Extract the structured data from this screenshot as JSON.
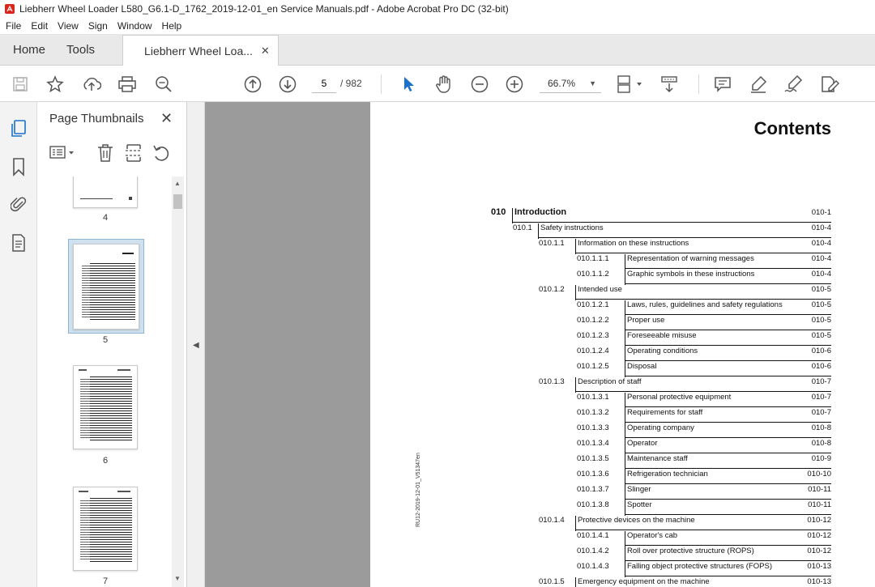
{
  "window": {
    "title": "Liebherr Wheel Loader L580_G6.1-D_1762_2019-12-01_en Service Manuals.pdf - Adobe Acrobat Pro DC (32-bit)"
  },
  "menu": [
    "File",
    "Edit",
    "View",
    "Sign",
    "Window",
    "Help"
  ],
  "tabs": {
    "home": "Home",
    "tools": "Tools",
    "document": "Liebherr Wheel Loa..."
  },
  "toolbar": {
    "current_page": "5",
    "total_pages": "/ 982",
    "zoom": "66.7%",
    "icons": [
      "save-icon",
      "bookmark-star-icon",
      "cloud-upload-icon",
      "print-icon",
      "search-zoom-icon",
      "page-up-icon",
      "page-down-icon",
      "select-cursor-icon",
      "hand-icon",
      "zoom-out-icon",
      "zoom-in-icon",
      "page-fit-icon",
      "scroll-mode-icon",
      "comment-icon",
      "highlight-icon",
      "sign-icon",
      "fill-sign-icon"
    ]
  },
  "panel": {
    "title": "Page Thumbnails",
    "thumbnails": [
      {
        "label": "4"
      },
      {
        "label": "5",
        "selected": true
      },
      {
        "label": "6"
      },
      {
        "label": "7"
      }
    ]
  },
  "document": {
    "heading": "Contents",
    "side_code": "RU12-2019-12-01_V51347en",
    "toc": [
      {
        "level": 0,
        "num": "010",
        "label": "Introduction",
        "page": "010-1"
      },
      {
        "level": 1,
        "num": "010.1",
        "label": "Safety instructions",
        "page": "010-4"
      },
      {
        "level": 2,
        "num": "010.1.1",
        "label": "Information on these instructions",
        "page": "010-4"
      },
      {
        "level": 3,
        "num": "010.1.1.1",
        "label": "Representation of warning messages",
        "page": "010-4"
      },
      {
        "level": 3,
        "num": "010.1.1.2",
        "label": "Graphic symbols in these instructions",
        "page": "010-4"
      },
      {
        "level": 2,
        "num": "010.1.2",
        "label": "Intended use",
        "page": "010-5"
      },
      {
        "level": 3,
        "num": "010.1.2.1",
        "label": "Laws, rules, guidelines and safety regulations",
        "page": "010-5"
      },
      {
        "level": 3,
        "num": "010.1.2.2",
        "label": "Proper use",
        "page": "010-5"
      },
      {
        "level": 3,
        "num": "010.1.2.3",
        "label": "Foreseeable misuse",
        "page": "010-5"
      },
      {
        "level": 3,
        "num": "010.1.2.4",
        "label": "Operating conditions",
        "page": "010-6"
      },
      {
        "level": 3,
        "num": "010.1.2.5",
        "label": "Disposal",
        "page": "010-6"
      },
      {
        "level": 2,
        "num": "010.1.3",
        "label": "Description of staff",
        "page": "010-7"
      },
      {
        "level": 3,
        "num": "010.1.3.1",
        "label": "Personal protective equipment",
        "page": "010-7"
      },
      {
        "level": 3,
        "num": "010.1.3.2",
        "label": "Requirements for staff",
        "page": "010-7"
      },
      {
        "level": 3,
        "num": "010.1.3.3",
        "label": "Operating company",
        "page": "010-8"
      },
      {
        "level": 3,
        "num": "010.1.3.4",
        "label": "Operator",
        "page": "010-8"
      },
      {
        "level": 3,
        "num": "010.1.3.5",
        "label": "Maintenance staff",
        "page": "010-9"
      },
      {
        "level": 3,
        "num": "010.1.3.6",
        "label": "Refrigeration technician",
        "page": "010-10"
      },
      {
        "level": 3,
        "num": "010.1.3.7",
        "label": "Slinger",
        "page": "010-11"
      },
      {
        "level": 3,
        "num": "010.1.3.8",
        "label": "Spotter",
        "page": "010-11"
      },
      {
        "level": 2,
        "num": "010.1.4",
        "label": "Protective devices on the machine",
        "page": "010-12"
      },
      {
        "level": 3,
        "num": "010.1.4.1",
        "label": "Operator's cab",
        "page": "010-12"
      },
      {
        "level": 3,
        "num": "010.1.4.2",
        "label": "Roll over protective structure (ROPS)",
        "page": "010-12"
      },
      {
        "level": 3,
        "num": "010.1.4.3",
        "label": "Falling object protective structures (FOPS)",
        "page": "010-13"
      },
      {
        "level": 2,
        "num": "010.1.5",
        "label": "Emergency equipment on the machine",
        "page": "010-13"
      }
    ]
  },
  "colors": {
    "accent": "#1a73c8",
    "tabbar": "#e9e9e9",
    "canvas_gray": "#9b9b9b",
    "icon": "#555555"
  }
}
